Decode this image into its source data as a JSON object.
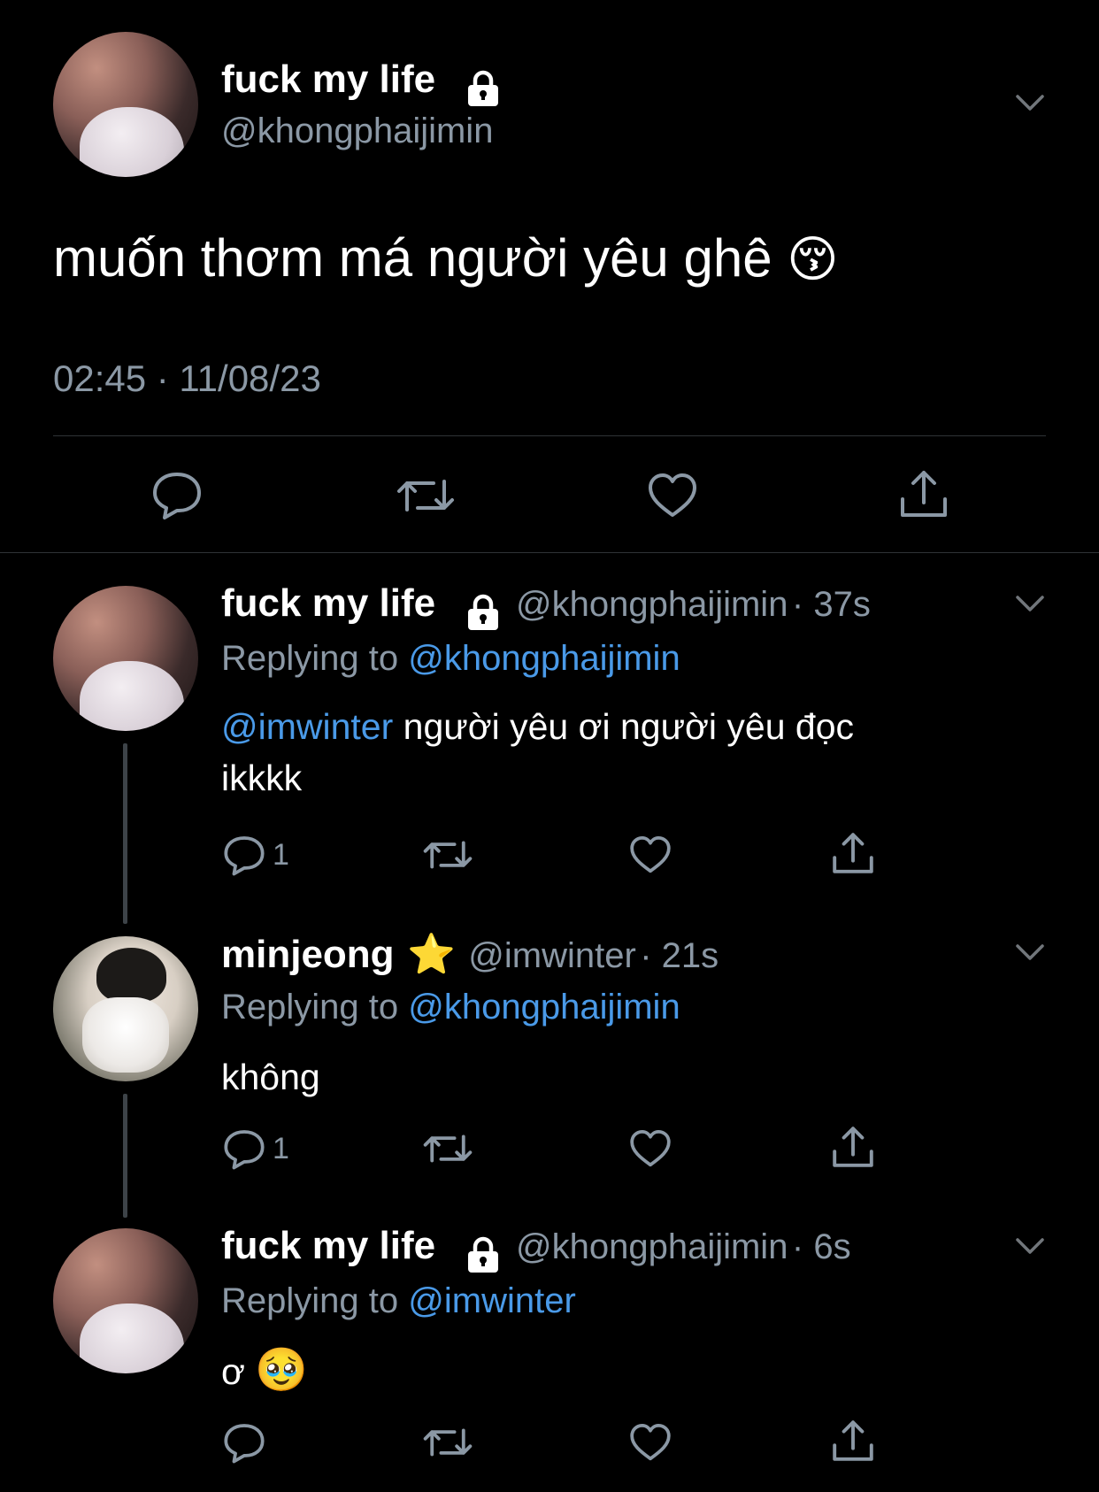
{
  "main_tweet": {
    "name": "fuck my life",
    "handle": "@khongphaijimin",
    "text": "muốn thơm má người yêu ghê",
    "emoji": "😚",
    "timestamp": "02:45 · 11/08/23"
  },
  "replies": [
    {
      "name": "fuck my life",
      "handle": "@khongphaijimin",
      "time": "· 37s",
      "replying_label": "Replying to",
      "replying_to": "@khongphaijimin",
      "mention": "@imwinter",
      "text_line1": "người yêu ơi người yêu đọc",
      "text_line2": "ikkkk",
      "reply_count": "1"
    },
    {
      "name": "minjeong",
      "badge": "⭐",
      "handle": "@imwinter",
      "time": "· 21s",
      "replying_label": "Replying to",
      "replying_to": "@khongphaijimin",
      "text": "không",
      "reply_count": "1"
    },
    {
      "name": "fuck my life",
      "handle": "@khongphaijimin",
      "time": "· 6s",
      "replying_label": "Replying to",
      "replying_to": "@imwinter",
      "text": "ơ",
      "emoji": "🥹"
    }
  ],
  "icons": {
    "reply": "reply-icon",
    "retweet": "retweet-icon",
    "like": "heart-icon",
    "share": "share-icon",
    "lock": "lock-icon",
    "more": "chevron-down-icon"
  },
  "colors": {
    "background": "#000000",
    "link": "#4a9ae8",
    "secondary": "#8b98a5",
    "divider": "#2f3336"
  }
}
